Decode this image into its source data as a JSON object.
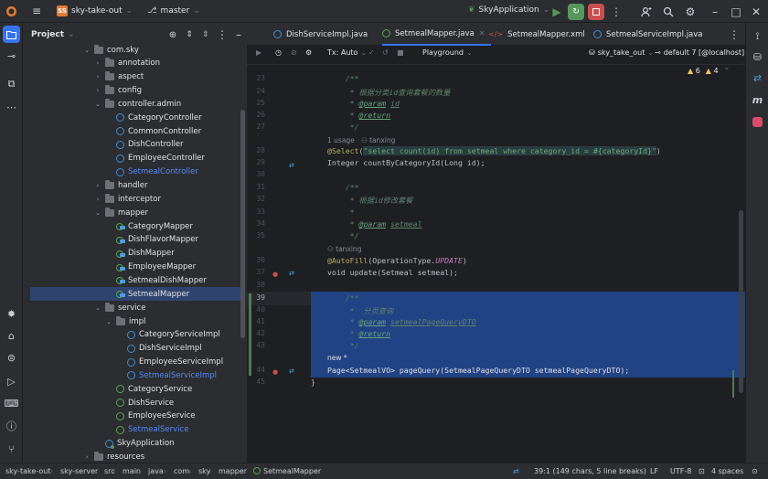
{
  "titlebar": {
    "project_initials": "SS",
    "project_name": "sky-take-out",
    "branch": "master",
    "run_config": "SkyApplication"
  },
  "project_panel": {
    "title": "Project",
    "tree": [
      {
        "label": "com.sky",
        "indent": 0,
        "type": "folder",
        "open": true
      },
      {
        "label": "annotation",
        "indent": 1,
        "type": "folder"
      },
      {
        "label": "aspect",
        "indent": 1,
        "type": "folder"
      },
      {
        "label": "config",
        "indent": 1,
        "type": "folder"
      },
      {
        "label": "controller.admin",
        "indent": 1,
        "type": "folder",
        "open": true
      },
      {
        "label": "CategoryController",
        "indent": 2,
        "type": "class"
      },
      {
        "label": "CommonController",
        "indent": 2,
        "type": "class"
      },
      {
        "label": "DishController",
        "indent": 2,
        "type": "class"
      },
      {
        "label": "EmployeeController",
        "indent": 2,
        "type": "class"
      },
      {
        "label": "SetmealController",
        "indent": 2,
        "type": "class",
        "blue": true
      },
      {
        "label": "handler",
        "indent": 1,
        "type": "folder"
      },
      {
        "label": "interceptor",
        "indent": 1,
        "type": "folder"
      },
      {
        "label": "mapper",
        "indent": 1,
        "type": "folder",
        "open": true
      },
      {
        "label": "CategoryMapper",
        "indent": 2,
        "type": "mapper"
      },
      {
        "label": "DishFlavorMapper",
        "indent": 2,
        "type": "mapper"
      },
      {
        "label": "DishMapper",
        "indent": 2,
        "type": "mapper"
      },
      {
        "label": "EmployeeMapper",
        "indent": 2,
        "type": "mapper"
      },
      {
        "label": "SetmealDishMapper",
        "indent": 2,
        "type": "mapper"
      },
      {
        "label": "SetmealMapper",
        "indent": 2,
        "type": "mapper",
        "selected": true
      },
      {
        "label": "service",
        "indent": 1,
        "type": "folder",
        "open": true
      },
      {
        "label": "impl",
        "indent": 2,
        "type": "folder",
        "open": true
      },
      {
        "label": "CategoryServiceImpl",
        "indent": 3,
        "type": "class"
      },
      {
        "label": "DishServiceImpl",
        "indent": 3,
        "type": "class"
      },
      {
        "label": "EmployeeServiceImpl",
        "indent": 3,
        "type": "class"
      },
      {
        "label": "SetmealServiceImpl",
        "indent": 3,
        "type": "class",
        "blue": true
      },
      {
        "label": "CategoryService",
        "indent": 2,
        "type": "interface"
      },
      {
        "label": "DishService",
        "indent": 2,
        "type": "interface"
      },
      {
        "label": "EmployeeService",
        "indent": 2,
        "type": "interface"
      },
      {
        "label": "SetmealService",
        "indent": 2,
        "type": "interface",
        "blue": true
      },
      {
        "label": "SkyApplication",
        "indent": 1,
        "type": "app"
      },
      {
        "label": "resources",
        "indent": 0,
        "type": "folder"
      }
    ]
  },
  "tabs": [
    {
      "label": "DishServiceImpl.java",
      "kind": "java"
    },
    {
      "label": "SetmealMapper.java",
      "kind": "java",
      "active": true
    },
    {
      "label": "SetmealMapper.xml",
      "kind": "xml"
    },
    {
      "label": "SetmealServiceImpl.java",
      "kind": "java"
    }
  ],
  "editor_toolbar": {
    "tx": "Tx: Auto",
    "playground": "Playground",
    "datasource": "sky_take_out",
    "db": "default 7 [@localhost]",
    "warnings": "6",
    "checks": "4"
  },
  "code": {
    "hint_28": "1 usage",
    "hint_28_author": "tanxing",
    "hint_36_author": "tanxing",
    "hint_44_new": "new *",
    "comment_24": "根据分类id查询套餐的数量",
    "comment_32": "根据id修改套餐",
    "comment_40": "分页查询",
    "sql": "select count(id) from setmeal where category_id = #{categoryId}",
    "line_29": "Integer countByCategoryId(Long id);",
    "line_37": "void update(Setmeal setmeal);",
    "line_44": "Page<SetmealVO> pageQuery(SetmealPageQueryDTO setmealPageQueryDTO);"
  },
  "statusbar": {
    "crumbs": [
      "sky-take-out",
      "sky-server",
      "src",
      "main",
      "java",
      "com",
      "sky",
      "mapper",
      "SetmealMapper"
    ],
    "position": "39:1 (149 chars, 5 line breaks)",
    "line_sep": "LF",
    "encoding": "UTF-8",
    "indent": "4 spaces"
  }
}
